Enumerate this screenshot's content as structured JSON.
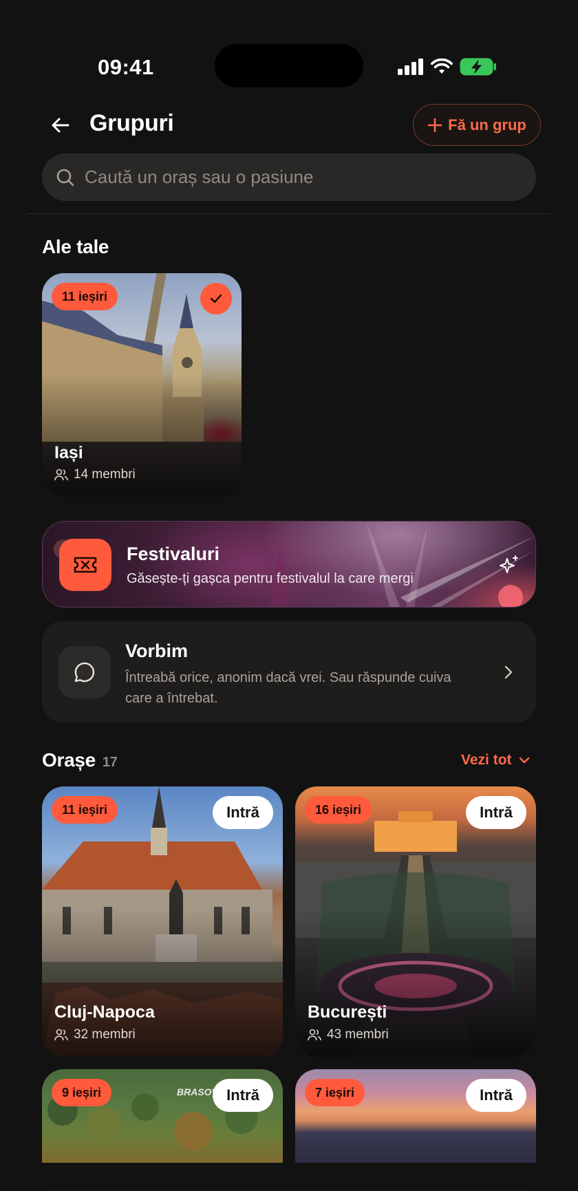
{
  "status_bar": {
    "time": "09:41"
  },
  "header": {
    "title": "Grupuri",
    "create_label": "Fă un grup"
  },
  "search": {
    "placeholder": "Caută un oraș sau o pasiune"
  },
  "mine": {
    "title": "Ale tale",
    "card": {
      "badge": "11 ieșiri",
      "name": "Iași",
      "members": "14 membri"
    }
  },
  "festival": {
    "title": "Festivaluri",
    "subtitle": "Găsește-ți gașca pentru festivalul la care mergi"
  },
  "vorbim": {
    "title": "Vorbim",
    "desc": "Întreabă orice, anonim dacă vrei. Sau răspunde cuiva care a întrebat."
  },
  "cities": {
    "title": "Orașe",
    "count": "17",
    "see_all": "Vezi tot",
    "join_label": "Intră",
    "items": [
      {
        "badge": "11 ieșiri",
        "name": "Cluj-Napoca",
        "members": "32 membri"
      },
      {
        "badge": "16 ieșiri",
        "name": "București",
        "members": "43 membri"
      },
      {
        "badge": "9 ieșiri",
        "name": "",
        "members": "",
        "sign": "BRASOV"
      },
      {
        "badge": "7 ieșiri",
        "name": "",
        "members": ""
      }
    ]
  },
  "colors": {
    "accent": "#ff5a3c",
    "background": "#121212",
    "surface": "#1f1d1c"
  }
}
